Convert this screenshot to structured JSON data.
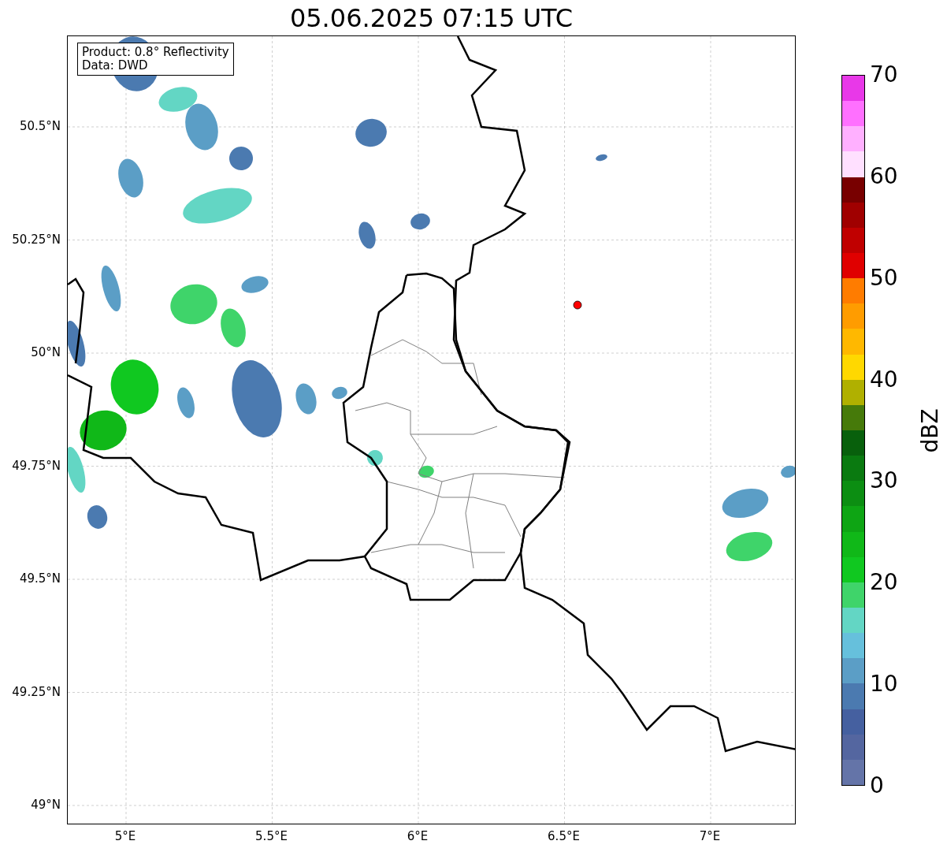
{
  "title": "05.06.2025 07:15 UTC",
  "map": {
    "info_box": [
      "Product: 0.8° Reflectivity",
      "Data: DWD"
    ],
    "yticks": [
      "50.5°N",
      "50.25°N",
      "50°N",
      "49.75°N",
      "49.5°N",
      "49.25°N",
      "49°N"
    ],
    "xticks": [
      "5°E",
      "5.5°E",
      "6°E",
      "6.5°E",
      "7°E"
    ]
  },
  "colorbar": {
    "label": "dBZ",
    "ticks": [
      "70",
      "60",
      "50",
      "40",
      "30",
      "20",
      "10",
      "0"
    ],
    "bins": [
      {
        "color": "#e838e8"
      },
      {
        "color": "#ff70ff"
      },
      {
        "color": "#ffb0ff"
      },
      {
        "color": "#ffe0ff"
      },
      {
        "color": "#780000"
      },
      {
        "color": "#a00000"
      },
      {
        "color": "#c00000"
      },
      {
        "color": "#e00000"
      },
      {
        "color": "#ff7c00"
      },
      {
        "color": "#ff9c00"
      },
      {
        "color": "#ffb800"
      },
      {
        "color": "#ffd800"
      },
      {
        "color": "#b0b000"
      },
      {
        "color": "#467a0a"
      },
      {
        "color": "#08600c"
      },
      {
        "color": "#0a7a10"
      },
      {
        "color": "#0c8e12"
      },
      {
        "color": "#0ea514"
      },
      {
        "color": "#10b818"
      },
      {
        "color": "#10c820"
      },
      {
        "color": "#3fd46a"
      },
      {
        "color": "#63d6c4"
      },
      {
        "color": "#66c0dc"
      },
      {
        "color": "#5b9ec6"
      },
      {
        "color": "#4b7ab0"
      },
      {
        "color": "#4560a0"
      },
      {
        "color": "#5466a0"
      },
      {
        "color": "#6474a8"
      }
    ]
  }
}
